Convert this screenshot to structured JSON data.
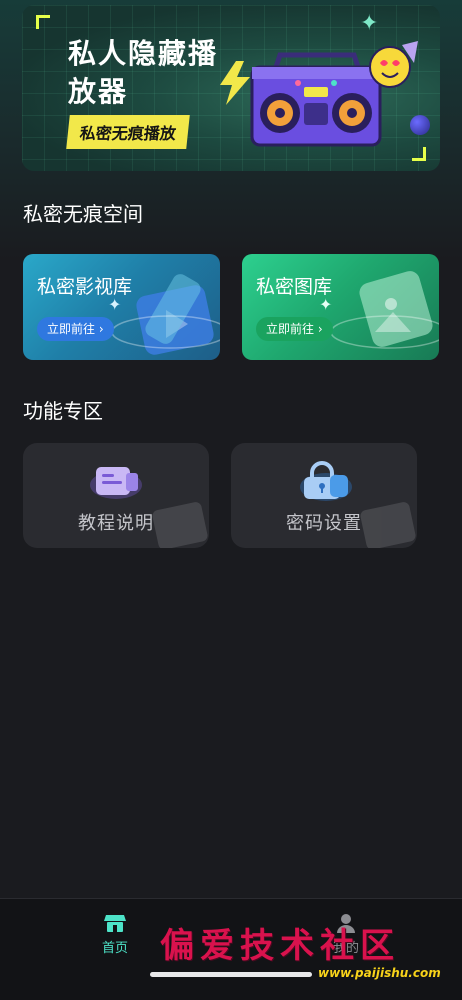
{
  "banner": {
    "title": "私人隐藏播放器",
    "tag": "私密无痕播放"
  },
  "sections": {
    "private_space": "私密无痕空间",
    "features": "功能专区"
  },
  "cards": [
    {
      "title": "私密影视库",
      "button": "立即前往 ›"
    },
    {
      "title": "私密图库",
      "button": "立即前往 ›"
    }
  ],
  "tiles": [
    {
      "label": "教程说明",
      "icon": "document-icon"
    },
    {
      "label": "密码设置",
      "icon": "lock-icon"
    }
  ],
  "bottom_nav": {
    "home": "首页",
    "mine": "我的"
  },
  "watermark": {
    "text": "偏爱技术社区",
    "url": "www.paijishu.com"
  },
  "colors": {
    "accent": "#4de3c8",
    "tag_yellow": "#f2e84a",
    "video_card": "#1f7fa8",
    "gallery_card": "#1fa86f"
  }
}
